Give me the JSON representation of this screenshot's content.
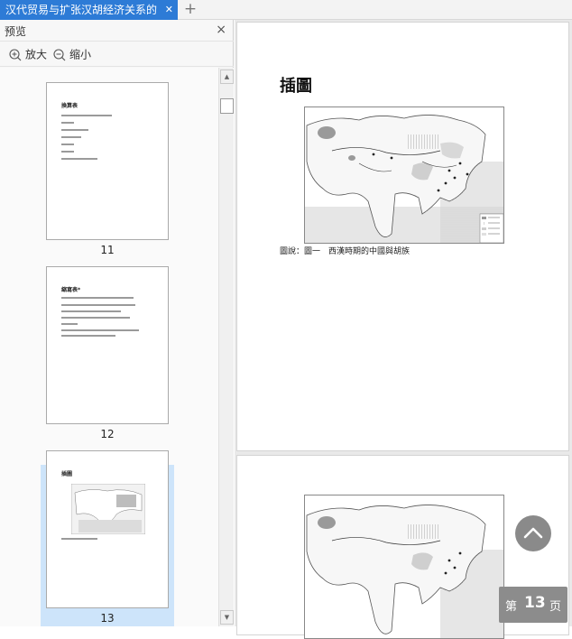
{
  "tab": {
    "title": "汉代贸易与扩张汉胡经济关系的",
    "close_icon": "close-icon",
    "add_icon": "plus-icon"
  },
  "panel": {
    "title": "预览",
    "zoom_in": "放大",
    "zoom_out": "缩小"
  },
  "thumbnails": [
    {
      "number": "11",
      "title": "換算表",
      "selected": false
    },
    {
      "number": "12",
      "title": "縮寫表*",
      "selected": false
    },
    {
      "number": "13",
      "title": "插圖",
      "selected": true
    }
  ],
  "document": {
    "page1": {
      "heading": "插圖",
      "caption": "圖說：圖一　西漢時期的中國與胡族"
    }
  },
  "page_indicator": {
    "prefix": "第",
    "number": "13",
    "suffix": "页"
  },
  "colors": {
    "accent": "#2d7bd6",
    "selection": "#cde4fa"
  }
}
